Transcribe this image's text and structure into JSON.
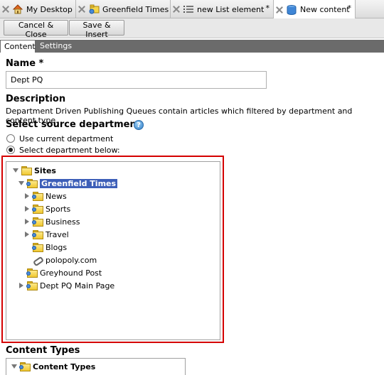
{
  "tabs": [
    {
      "label": "My Desktop",
      "icon": "home-icon"
    },
    {
      "label": "Greenfield Times",
      "icon": "site-folder-icon"
    },
    {
      "label": "new List element",
      "icon": "list-icon",
      "modified": "*"
    },
    {
      "label": "New content",
      "icon": "database-icon",
      "modified": "*"
    }
  ],
  "toolbar": {
    "cancel_label": "Cancel & Close",
    "save_label": "Save & Insert"
  },
  "subtabs": {
    "content": "Content",
    "settings": "Settings"
  },
  "name": {
    "label": "Name *",
    "value": "Dept PQ"
  },
  "description": {
    "heading": "Description",
    "text": "Department Driven Publishing Queues contain articles which filtered by department and content type."
  },
  "source": {
    "heading": "Select source department",
    "help_icon": "help-icon",
    "options": [
      "Use current department",
      "Select department below:"
    ],
    "selected_index": 1
  },
  "tree": {
    "root": "Sites",
    "nodes": [
      {
        "label": "Greenfield Times",
        "selected": true
      },
      {
        "label": "News"
      },
      {
        "label": "Sports"
      },
      {
        "label": "Business"
      },
      {
        "label": "Travel"
      },
      {
        "label": "Blogs"
      },
      {
        "label": "polopoly.com"
      },
      {
        "label": "Greyhound Post"
      },
      {
        "label": "Dept PQ Main Page"
      }
    ]
  },
  "content_types": {
    "heading": "Content Types",
    "root": "Content Types"
  },
  "colors": {
    "selection": "#3d5fb8",
    "highlight_border": "#d40000",
    "subtab_bar": "#6b6b6b"
  }
}
